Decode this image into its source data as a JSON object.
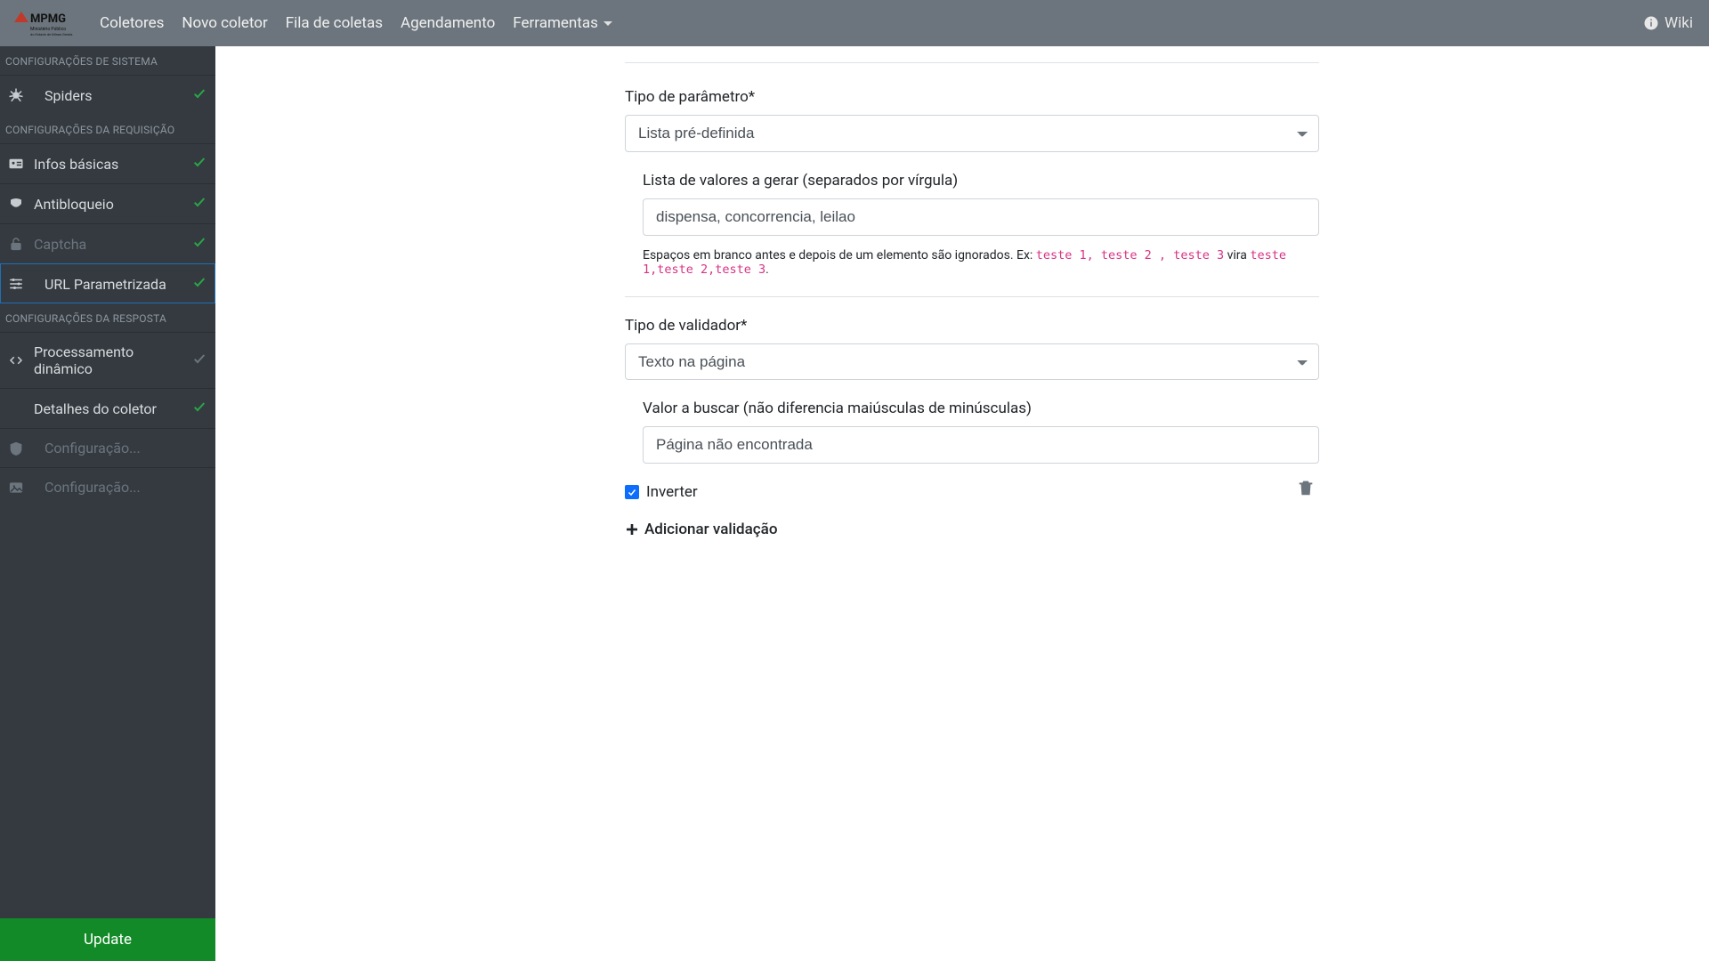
{
  "nav": {
    "links": [
      "Coletores",
      "Novo coletor",
      "Fila de coletas",
      "Agendamento"
    ],
    "tools": "Ferramentas",
    "wiki": "Wiki"
  },
  "sidebar": {
    "sections": {
      "sys": "CONFIGURAÇÕES DE SISTEMA",
      "req": "CONFIGURAÇÕES DA REQUISIÇÃO",
      "resp": "CONFIGURAÇÕES DA RESPOSTA"
    },
    "items": {
      "spiders": "Spiders",
      "infos": "Infos básicas",
      "antibloqueio": "Antibloqueio",
      "captcha": "Captcha",
      "url_param": "URL Parametrizada",
      "proc_din": "Processamento dinâmico",
      "detalhes": "Detalhes do coletor",
      "config_a": "Configuração...",
      "config_b": "Configuração..."
    },
    "update": "Update"
  },
  "form": {
    "param_type_label": "Tipo de parâmetro*",
    "param_type_value": "Lista pré-definida",
    "list_label": "Lista de valores a gerar (separados por vírgula)",
    "list_value": "dispensa, concorrencia, leilao",
    "help_prefix": "Espaços em branco antes e depois de um elemento são ignorados. Ex: ",
    "help_code1": "teste 1, teste 2 , teste 3",
    "help_mid": " vira ",
    "help_code2": "teste 1,teste 2,teste 3",
    "validator_label": "Tipo de validador*",
    "validator_value": "Texto na página",
    "search_label": "Valor a buscar (não diferencia maiúsculas de minúsculas)",
    "search_value": "Página não encontrada",
    "invert_label": "Inverter",
    "invert_checked": true,
    "add_validation": "Adicionar validação"
  }
}
